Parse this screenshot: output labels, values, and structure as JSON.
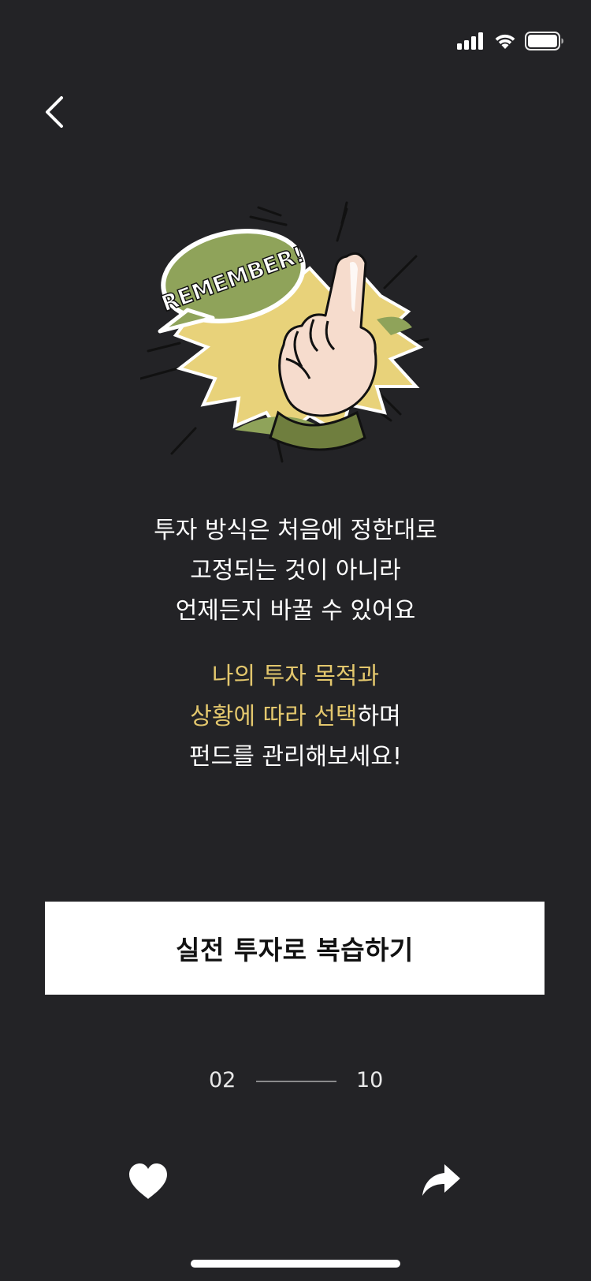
{
  "status_bar": {
    "icons": [
      "signal-icon",
      "wifi-icon",
      "battery-icon"
    ]
  },
  "nav": {
    "back_icon": "chevron-left-icon"
  },
  "illustration": {
    "icon": "pointing-finger-illustration",
    "bubble_text": "REMEMBER!"
  },
  "message": {
    "line1": "투자 방식은 처음에 정한대로",
    "line2": "고정되는 것이 아니라",
    "line3": "언제든지 바꿀 수 있어요"
  },
  "tip": {
    "line1": "나의 투자 목적과",
    "line2_highlight": "상황에 따라 선택",
    "line2_rest": "하며",
    "line3": "펀드를 관리해보세요!"
  },
  "cta": {
    "label": "실전 투자로 복습하기"
  },
  "pager": {
    "current": "02",
    "total": "10"
  },
  "actions": {
    "like_icon": "heart-icon",
    "share_icon": "share-arrow-icon"
  },
  "colors": {
    "background": "#232326",
    "highlight": "#e3c76d",
    "cta_background": "#ffffff",
    "illustration_green": "#8fa35a",
    "illustration_yellow": "#e8d27a"
  }
}
